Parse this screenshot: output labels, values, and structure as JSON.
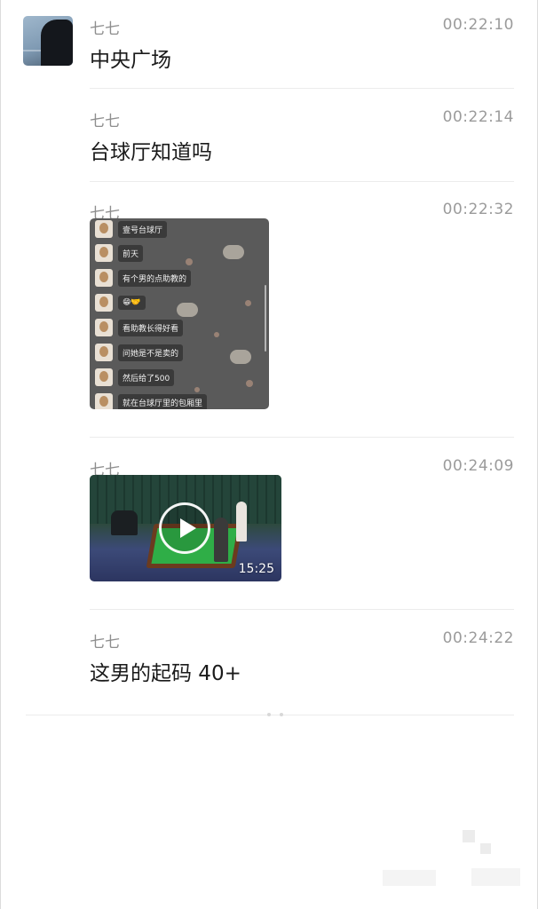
{
  "messages": [
    {
      "sender": "七七",
      "time": "00:22:10",
      "text": "中央广场"
    },
    {
      "sender": "七七",
      "time": "00:22:14",
      "text": "台球厅知道吗"
    },
    {
      "sender": "七七",
      "time": "00:22:32",
      "type": "image",
      "screenshot_lines": [
        "壹号台球厅",
        "前天",
        "有个男的点助教的",
        "😁🤝",
        "看助教长得好看",
        "问她是不是卖的",
        "然后给了500",
        "就在台球厅里的包厢里"
      ]
    },
    {
      "sender": "七七",
      "time": "00:24:09",
      "type": "video",
      "duration": "15:25",
      "icon": "play-icon"
    },
    {
      "sender": "七七",
      "time": "00:24:22",
      "text": "这男的起码 40+"
    }
  ],
  "colors": {
    "sender": "#8e8e8e",
    "time": "#9b9b9b",
    "text": "#1a1a1a",
    "divider": "#ececec"
  }
}
